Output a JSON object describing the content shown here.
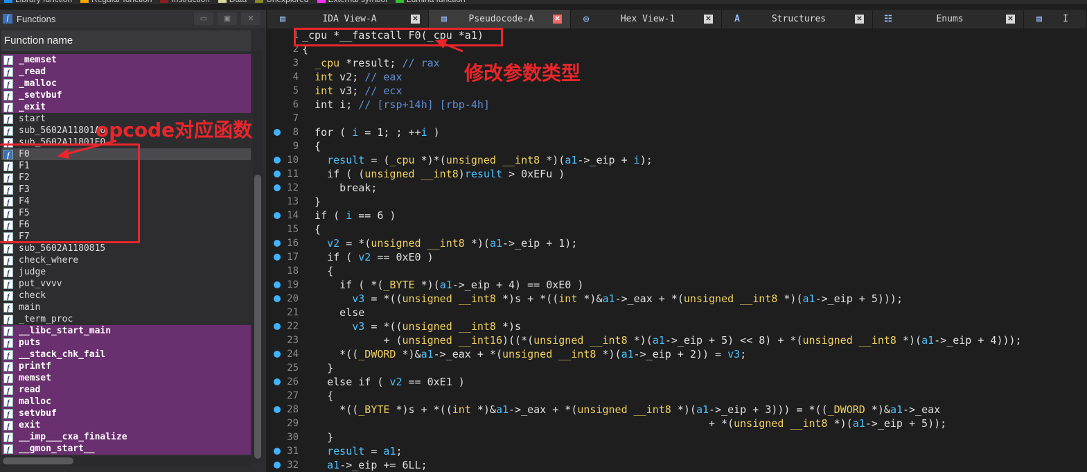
{
  "legend": [
    {
      "label": "Library function",
      "color": "#1e90ff"
    },
    {
      "label": "Regular function",
      "color": "#f2a900"
    },
    {
      "label": "Instruction",
      "color": "#8b1e1e"
    },
    {
      "label": "Data",
      "color": "#d8d89a"
    },
    {
      "label": "Unexplored",
      "color": "#8a8a2a"
    },
    {
      "label": "External symbol",
      "color": "#ff30ff"
    },
    {
      "label": "Lumina function",
      "color": "#2ec42e"
    }
  ],
  "functions_pane": {
    "title": "Functions",
    "column_header": "Function name",
    "items": [
      {
        "name": "_memset",
        "kind": "lib"
      },
      {
        "name": "_read",
        "kind": "lib"
      },
      {
        "name": "_malloc",
        "kind": "lib"
      },
      {
        "name": "_setvbuf",
        "kind": "lib"
      },
      {
        "name": "_exit",
        "kind": "lib"
      },
      {
        "name": "start",
        "kind": "reg"
      },
      {
        "name": "sub_5602A11801A0",
        "kind": "reg"
      },
      {
        "name": "sub_5602A11801E0",
        "kind": "reg"
      },
      {
        "name": "F0",
        "kind": "sel"
      },
      {
        "name": "F1",
        "kind": "reg"
      },
      {
        "name": "F2",
        "kind": "reg"
      },
      {
        "name": "F3",
        "kind": "reg"
      },
      {
        "name": "F4",
        "kind": "reg"
      },
      {
        "name": "F5",
        "kind": "reg"
      },
      {
        "name": "F6",
        "kind": "reg"
      },
      {
        "name": "F7",
        "kind": "reg"
      },
      {
        "name": "sub_5602A1180815",
        "kind": "reg"
      },
      {
        "name": "check_where",
        "kind": "reg"
      },
      {
        "name": "judge",
        "kind": "reg"
      },
      {
        "name": "put_vvvv",
        "kind": "reg"
      },
      {
        "name": "check",
        "kind": "reg"
      },
      {
        "name": "main",
        "kind": "reg"
      },
      {
        "name": "_term_proc",
        "kind": "reg"
      },
      {
        "name": "__libc_start_main",
        "kind": "lib"
      },
      {
        "name": "puts",
        "kind": "lib"
      },
      {
        "name": "__stack_chk_fail",
        "kind": "lib"
      },
      {
        "name": "printf",
        "kind": "lib"
      },
      {
        "name": "memset",
        "kind": "lib"
      },
      {
        "name": "read",
        "kind": "lib"
      },
      {
        "name": "malloc",
        "kind": "lib"
      },
      {
        "name": "setvbuf",
        "kind": "lib"
      },
      {
        "name": "exit",
        "kind": "lib"
      },
      {
        "name": "__imp___cxa_finalize",
        "kind": "lib"
      },
      {
        "name": "__gmon_start__",
        "kind": "lib"
      }
    ]
  },
  "tabs": [
    {
      "label": "IDA View-A",
      "icon": "ida-view-icon",
      "active": false
    },
    {
      "label": "Pseudocode-A",
      "icon": "pseudocode-icon",
      "active": true
    },
    {
      "label": "Hex View-1",
      "icon": "hex-view-icon",
      "active": false
    },
    {
      "label": "Structures",
      "icon": "structures-icon",
      "active": false
    },
    {
      "label": "Enums",
      "icon": "enums-icon",
      "active": false
    },
    {
      "label": "I",
      "icon": "imports-icon",
      "active": false
    }
  ],
  "code_lines": [
    {
      "n": "1",
      "dot": false,
      "html": "_cpu *__fastcall F0(_cpu *a1)"
    },
    {
      "n": "2",
      "dot": false,
      "html": "{"
    },
    {
      "n": "3",
      "dot": false,
      "html": "  <span class=\"k\">_cpu</span> *result; <span class=\"c\">// rax</span>"
    },
    {
      "n": "4",
      "dot": false,
      "html": "  <span class=\"k\">int</span> v2; <span class=\"c\">// eax</span>"
    },
    {
      "n": "5",
      "dot": false,
      "html": "  <span class=\"k\">int</span> v3; <span class=\"c\">// ecx</span>"
    },
    {
      "n": "6",
      "dot": false,
      "html": "  int i; <span class=\"c\">// [rsp+14h] [rbp-4h]</span>"
    },
    {
      "n": "7",
      "dot": false,
      "html": ""
    },
    {
      "n": "8",
      "dot": true,
      "html": "  for ( <span class=\"v\">i</span> = 1; ; ++<span class=\"v\">i</span> )"
    },
    {
      "n": "9",
      "dot": false,
      "html": "  {"
    },
    {
      "n": "10",
      "dot": true,
      "html": "    <span class=\"v\">result</span> = (<span class=\"k\">_cpu</span> *)*(<span class=\"k\">unsigned __int8</span> *)(<span class=\"v\">a1</span>->_eip + <span class=\"v\">i</span>);"
    },
    {
      "n": "11",
      "dot": true,
      "html": "    if ( (<span class=\"k\">unsigned __int8</span>)<span class=\"v\">result</span> > 0xEFu )"
    },
    {
      "n": "12",
      "dot": true,
      "html": "      break;"
    },
    {
      "n": "13",
      "dot": false,
      "html": "  }"
    },
    {
      "n": "14",
      "dot": true,
      "html": "  if ( <span class=\"v\">i</span> == 6 )"
    },
    {
      "n": "15",
      "dot": false,
      "html": "  {"
    },
    {
      "n": "16",
      "dot": true,
      "html": "    <span class=\"v\">v2</span> = *(<span class=\"k\">unsigned __int8</span> *)(<span class=\"v\">a1</span>->_eip + 1);"
    },
    {
      "n": "17",
      "dot": true,
      "html": "    if ( <span class=\"v\">v2</span> == 0xE0 )"
    },
    {
      "n": "18",
      "dot": false,
      "html": "    {"
    },
    {
      "n": "19",
      "dot": true,
      "html": "      if ( *(<span class=\"k\">_BYTE</span> *)(<span class=\"v\">a1</span>->_eip + 4) == 0xE0 )"
    },
    {
      "n": "20",
      "dot": true,
      "html": "        <span class=\"v\">v3</span> = *((<span class=\"k\">unsigned __int8</span> *)s + *((<span class=\"k\">int</span> *)&amp;<span class=\"v\">a1</span>->_eax + *(<span class=\"k\">unsigned __int8</span> *)(<span class=\"v\">a1</span>->_eip + 5)));"
    },
    {
      "n": "21",
      "dot": false,
      "html": "      else"
    },
    {
      "n": "22",
      "dot": true,
      "html": "        <span class=\"v\">v3</span> = *((<span class=\"k\">unsigned __int8</span> *)s"
    },
    {
      "n": "23",
      "dot": false,
      "html": "             + (<span class=\"k\">unsigned __int16</span>)((*(<span class=\"k\">unsigned __int8</span> *)(<span class=\"v\">a1</span>->_eip + 5) << 8) + *(<span class=\"k\">unsigned __int8</span> *)(<span class=\"v\">a1</span>->_eip + 4)));"
    },
    {
      "n": "24",
      "dot": true,
      "html": "      *((<span class=\"k\">_DWORD</span> *)&amp;<span class=\"v\">a1</span>->_eax + *(<span class=\"k\">unsigned __int8</span> *)(<span class=\"v\">a1</span>->_eip + 2)) = <span class=\"v\">v3</span>;"
    },
    {
      "n": "25",
      "dot": false,
      "html": "    }"
    },
    {
      "n": "26",
      "dot": true,
      "html": "    else if ( <span class=\"v\">v2</span> == 0xE1 )"
    },
    {
      "n": "27",
      "dot": false,
      "html": "    {"
    },
    {
      "n": "28",
      "dot": true,
      "html": "      *((<span class=\"k\">_BYTE</span> *)s + *((<span class=\"k\">int</span> *)&amp;<span class=\"v\">a1</span>->_eax + *(<span class=\"k\">unsigned __int8</span> *)(<span class=\"v\">a1</span>->_eip + 3))) = *((<span class=\"k\">_DWORD</span> *)&amp;<span class=\"v\">a1</span>->_eax"
    },
    {
      "n": "29",
      "dot": false,
      "html": "                                                                 + *(<span class=\"k\">unsigned __int8</span> *)(<span class=\"v\">a1</span>->_eip + 5));"
    },
    {
      "n": "30",
      "dot": false,
      "html": "    }"
    },
    {
      "n": "31",
      "dot": true,
      "html": "    <span class=\"v\">result</span> = <span class=\"v\">a1</span>;"
    },
    {
      "n": "32",
      "dot": true,
      "html": "    <span class=\"v\">a1</span>->_eip += 6LL;"
    }
  ],
  "annotations": {
    "modify_param_type": "修改参数类型",
    "opcode_functions": "opcode对应函数",
    "color": "#e8262b"
  }
}
